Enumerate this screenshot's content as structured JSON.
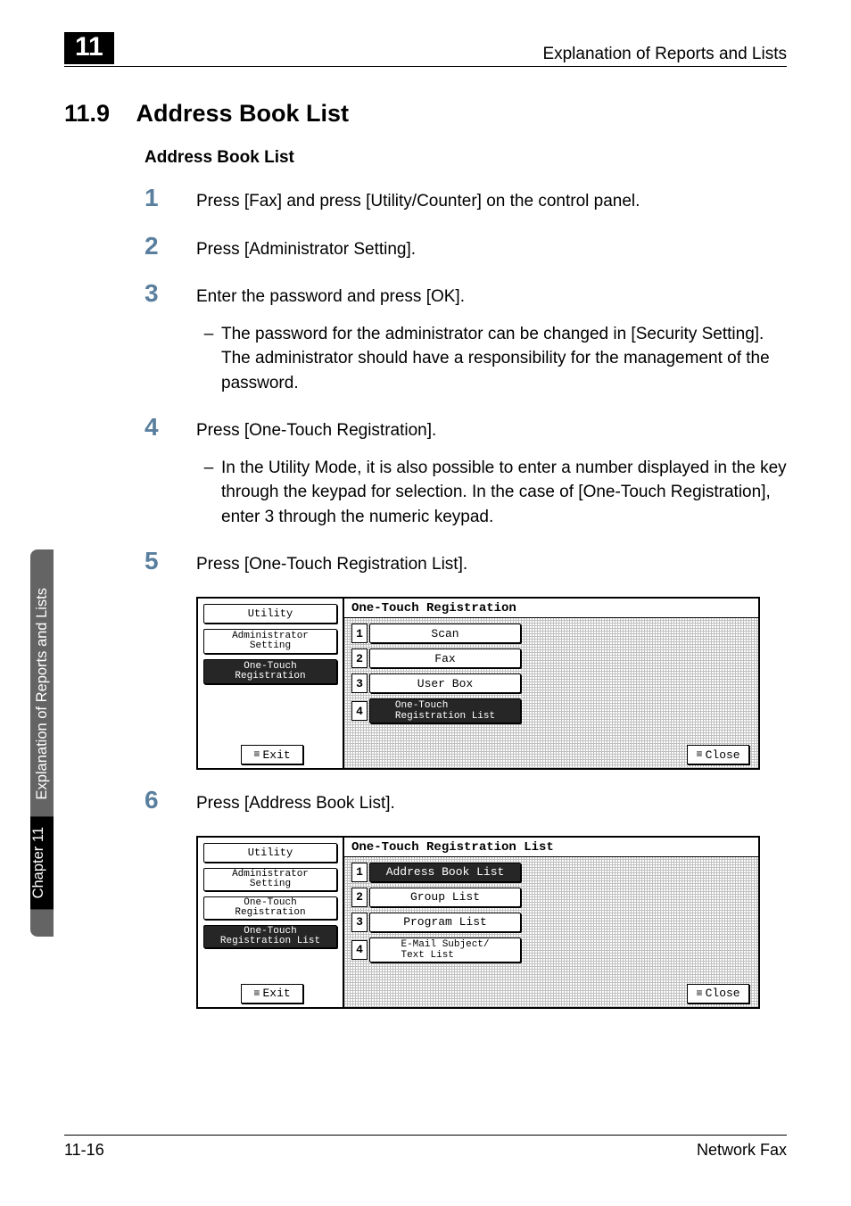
{
  "header": {
    "chapter_badge": "11",
    "right_text": "Explanation of Reports and Lists"
  },
  "section": {
    "number": "11.9",
    "title": "Address Book List"
  },
  "subtitle": "Address Book List",
  "steps": {
    "s1": {
      "num": "1",
      "text": "Press [Fax] and press [Utility/Counter] on the control panel."
    },
    "s2": {
      "num": "2",
      "text": "Press [Administrator Setting]."
    },
    "s3": {
      "num": "3",
      "text": "Enter the password and press [OK].",
      "sub_dash": "–",
      "sub_text": "The password for the administrator can be changed in [Security Setting]. The administrator should have a responsibility for the management of the password."
    },
    "s4": {
      "num": "4",
      "text": "Press [One-Touch Registration].",
      "sub_dash": "–",
      "sub_text": "In the Utility Mode, it is also possible to enter a number displayed in the key through the keypad for selection. In the case of [One-Touch Registration], enter 3 through the numeric keypad."
    },
    "s5": {
      "num": "5",
      "text": "Press [One-Touch Registration List]."
    },
    "s6": {
      "num": "6",
      "text": "Press [Address Book List]."
    }
  },
  "screens": {
    "a": {
      "title": "One-Touch Registration",
      "left": {
        "c1": "Utility",
        "c2": "Administrator\nSetting",
        "c3": "One-Touch\nRegistration"
      },
      "rows": {
        "r1": {
          "idx": "1",
          "label": "Scan"
        },
        "r2": {
          "idx": "2",
          "label": "Fax"
        },
        "r3": {
          "idx": "3",
          "label": "User Box"
        },
        "r4": {
          "idx": "4",
          "label": "One-Touch\nRegistration List"
        }
      },
      "exit": "Exit",
      "close": "Close"
    },
    "b": {
      "title": "One-Touch Registration List",
      "left": {
        "c1": "Utility",
        "c2": "Administrator\nSetting",
        "c3": "One-Touch\nRegistration",
        "c4": "One-Touch\nRegistration List"
      },
      "rows": {
        "r1": {
          "idx": "1",
          "label": "Address Book List"
        },
        "r2": {
          "idx": "2",
          "label": "Group List"
        },
        "r3": {
          "idx": "3",
          "label": "Program List"
        },
        "r4": {
          "idx": "4",
          "label": "E-Mail Subject/\nText List"
        }
      },
      "exit": "Exit",
      "close": "Close"
    }
  },
  "side_tab": {
    "line1": "Explanation of Reports and Lists",
    "line2": "Chapter 11"
  },
  "footer": {
    "left": "11-16",
    "right": "Network Fax"
  }
}
